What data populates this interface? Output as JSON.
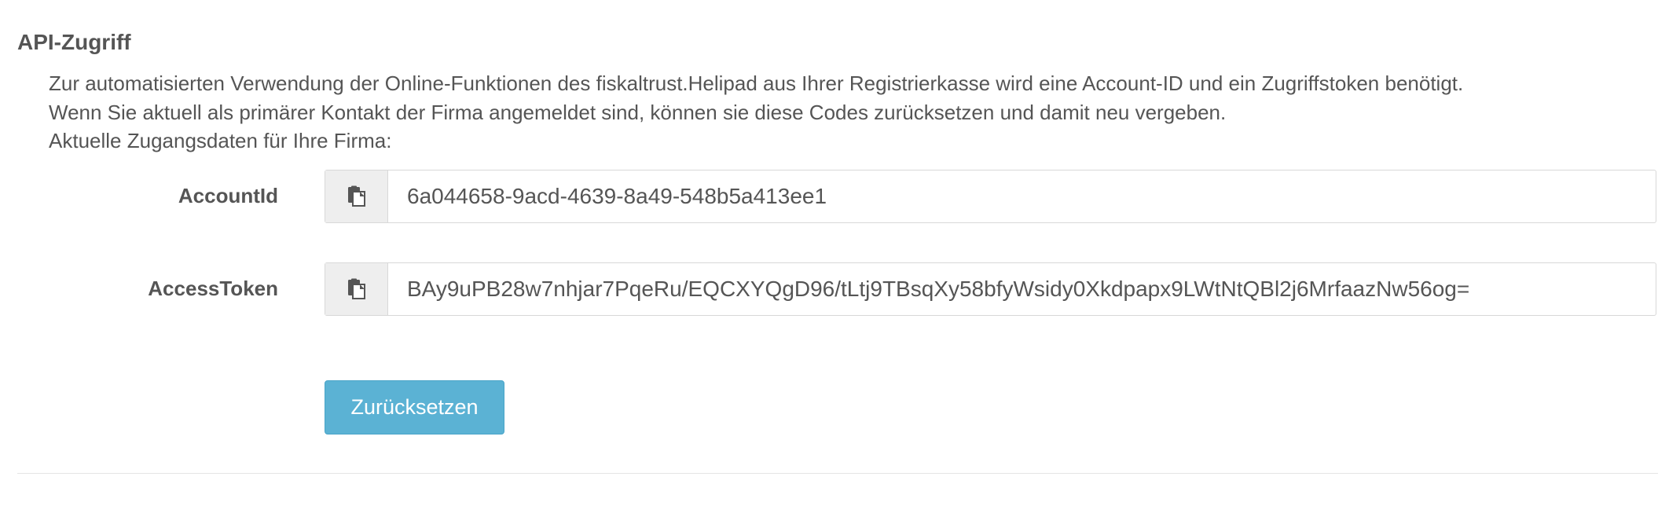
{
  "section": {
    "title": "API-Zugriff",
    "description_lines": [
      "Zur automatisierten Verwendung der Online-Funktionen des fiskaltrust.Helipad aus Ihrer Registrierkasse wird eine Account-ID und ein Zugriffstoken benötigt.",
      "Wenn Sie aktuell als primärer Kontakt der Firma angemeldet sind, können sie diese Codes zurücksetzen und damit neu vergeben.",
      "Aktuelle Zugangsdaten für Ihre Firma:"
    ]
  },
  "fields": {
    "account_id": {
      "label": "AccountId",
      "value": "6a044658-9acd-4639-8a49-548b5a413ee1",
      "icon": "clipboard-copy-icon"
    },
    "access_token": {
      "label": "AccessToken",
      "value": "BAy9uPB28w7nhjar7PqeRu/EQCXYQgD96/tLtj9TBsqXy58bfyWsidy0Xkdpapx9LWtNtQBl2j6MrfaazNw56og=",
      "icon": "clipboard-copy-icon"
    }
  },
  "actions": {
    "reset_label": "Zurücksetzen"
  },
  "colors": {
    "text": "#555555",
    "addon_background": "#eeeeee",
    "border": "#d8d8d8",
    "button_background": "#5bb2d4",
    "button_text": "#ffffff"
  }
}
